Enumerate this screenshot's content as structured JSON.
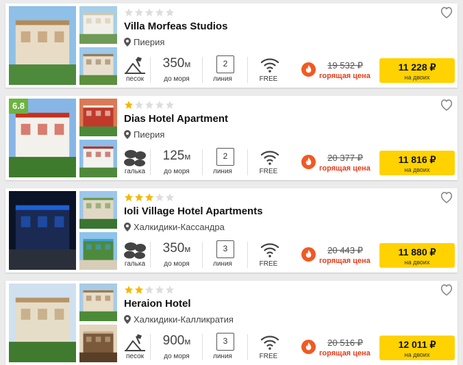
{
  "colors": {
    "accent": "#ffd200",
    "hot": "#e53c1b",
    "star_on": "#f5b800",
    "star_off": "#dddddd",
    "badge": "#6cb33f"
  },
  "hotels": [
    {
      "name": "Villa Morfeas Studios",
      "stars": 0,
      "rating": "",
      "location": "Пиерия",
      "beach_label": "песок",
      "distance_value": "350",
      "distance_unit": "м",
      "distance_label": "до моря",
      "line_value": "2",
      "line_label": "линия",
      "wifi_label": "FREE",
      "old_price": "19 532 ₽",
      "hot_label": "горящая цена",
      "price": "11 228 ₽",
      "price_note": "на двоих"
    },
    {
      "name": "Dias Hotel Apartment",
      "stars": 1,
      "rating": "6.8",
      "location": "Пиерия",
      "beach_label": "галька",
      "distance_value": "125",
      "distance_unit": "м",
      "distance_label": "до моря",
      "line_value": "2",
      "line_label": "линия",
      "wifi_label": "FREE",
      "old_price": "20 377 ₽",
      "hot_label": "горящая цена",
      "price": "11 816 ₽",
      "price_note": "на двоих"
    },
    {
      "name": "Ioli Village Hotel Apartments",
      "stars": 3,
      "rating": "",
      "location": "Халкидики-Кассандра",
      "beach_label": "галька",
      "distance_value": "350",
      "distance_unit": "м",
      "distance_label": "до моря",
      "line_value": "3",
      "line_label": "линия",
      "wifi_label": "FREE",
      "old_price": "20 443 ₽",
      "hot_label": "горящая цена",
      "price": "11 880 ₽",
      "price_note": "на двоих"
    },
    {
      "name": "Heraion Hotel",
      "stars": 2,
      "rating": "",
      "location": "Халкидики-Калликратия",
      "beach_label": "песок",
      "distance_value": "900",
      "distance_unit": "м",
      "distance_label": "до моря",
      "line_value": "3",
      "line_label": "линия",
      "wifi_label": "FREE",
      "old_price": "20 516 ₽",
      "hot_label": "горящая цена",
      "price": "12 011 ₽",
      "price_note": "на двоих"
    }
  ]
}
